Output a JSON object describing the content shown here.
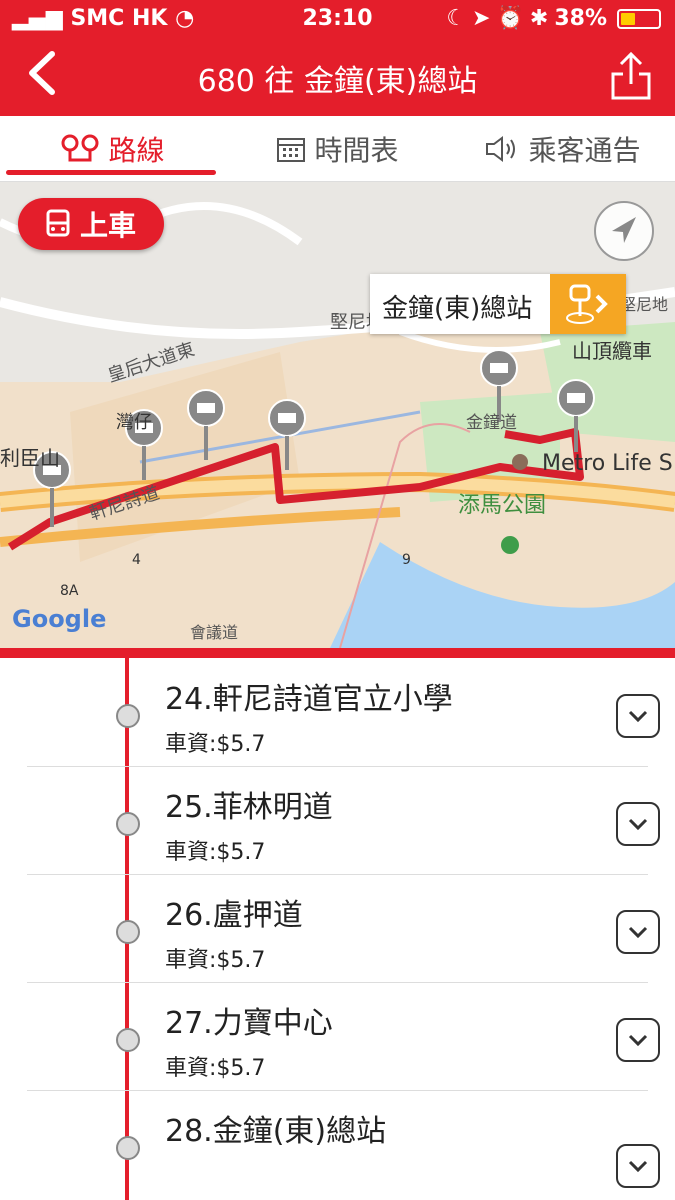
{
  "status": {
    "carrier": "SMC HK",
    "time": "23:10",
    "battery": "38%"
  },
  "nav": {
    "title": "680 往 金鐘(東)總站"
  },
  "tabs": [
    {
      "label": "路線"
    },
    {
      "label": "時間表"
    },
    {
      "label": "乘客通告"
    }
  ],
  "map": {
    "board_label": "上車",
    "callout_label": "金鐘(東)總站",
    "labels": {
      "kennedy_rd": "堅尼地道",
      "queens_rd_e": "皇后大道東",
      "hennessy": "軒尼詩道",
      "admiralty_rd": "金鐘道",
      "metro_life": "Metro Life S",
      "tamar_park": "添馬公園",
      "peak_tram": "山頂纜車",
      "harcourt_rd": "會議道",
      "wanchai": "灣仔",
      "lee_garden": "利臣山",
      "kennedy2": "堅尼地",
      "kennedy3": "堅尼地",
      "road9": "9",
      "road4": "4",
      "road8a": "8A",
      "google": "Google"
    }
  },
  "stops": [
    {
      "name": "24.軒尼詩道官立小學",
      "fare": "車資:$5.7"
    },
    {
      "name": "25.菲林明道",
      "fare": "車資:$5.7"
    },
    {
      "name": "26.盧押道",
      "fare": "車資:$5.7"
    },
    {
      "name": "27.力寶中心",
      "fare": "車資:$5.7"
    },
    {
      "name": "28.金鐘(東)總站",
      "fare": ""
    }
  ]
}
